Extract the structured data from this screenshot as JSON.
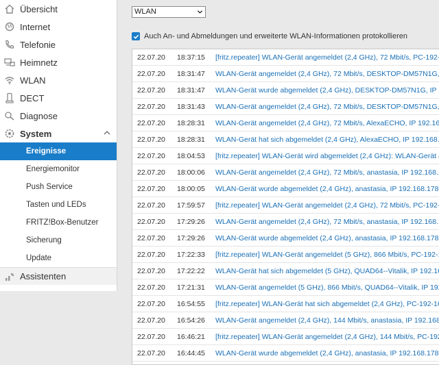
{
  "sidebar": {
    "items": [
      {
        "label": "Übersicht",
        "icon": "home-icon"
      },
      {
        "label": "Internet",
        "icon": "globe-icon"
      },
      {
        "label": "Telefonie",
        "icon": "phone-icon"
      },
      {
        "label": "Heimnetz",
        "icon": "network-icon"
      },
      {
        "label": "WLAN",
        "icon": "wifi-icon"
      },
      {
        "label": "DECT",
        "icon": "dect-handset-icon"
      },
      {
        "label": "Diagnose",
        "icon": "diagnose-icon"
      },
      {
        "label": "System",
        "icon": "gear-icon"
      }
    ],
    "system_subitems": [
      {
        "label": "Ereignisse",
        "active": true
      },
      {
        "label": "Energiemonitor"
      },
      {
        "label": "Push Service"
      },
      {
        "label": "Tasten und LEDs"
      },
      {
        "label": "FRITZ!Box-Benutzer"
      },
      {
        "label": "Sicherung"
      },
      {
        "label": "Update"
      }
    ],
    "assistant": {
      "label": "Assistenten",
      "icon": "wizard-icon"
    }
  },
  "filter": {
    "selected": "WLAN"
  },
  "log_option": {
    "label": "Auch An- und Abmeldungen und erweiterte WLAN-Informationen protokollieren",
    "checked": true
  },
  "log": {
    "rows": [
      {
        "date": "22.07.20",
        "time": "18:37:15",
        "msg": "[fritz.repeater] WLAN-Gerät angemeldet (2,4 GHz), 72 Mbit/s, PC-192-16"
      },
      {
        "date": "22.07.20",
        "time": "18:31:47",
        "msg": "WLAN-Gerät angemeldet (2,4 GHz), 72 Mbit/s, DESKTOP-DM57N1G, IP 1"
      },
      {
        "date": "22.07.20",
        "time": "18:31:47",
        "msg": "WLAN-Gerät wurde abgemeldet (2,4 GHz), DESKTOP-DM57N1G, IP 192."
      },
      {
        "date": "22.07.20",
        "time": "18:31:43",
        "msg": "WLAN-Gerät angemeldet (2,4 GHz), 72 Mbit/s, DESKTOP-DM57N1G, IP 1"
      },
      {
        "date": "22.07.20",
        "time": "18:28:31",
        "msg": "WLAN-Gerät angemeldet (2,4 GHz), 72 Mbit/s, AlexaECHO, IP 192.168.1"
      },
      {
        "date": "22.07.20",
        "time": "18:28:31",
        "msg": "WLAN-Gerät hat sich abgemeldet (2,4 GHz), AlexaECHO, IP 192.168.17"
      },
      {
        "date": "22.07.20",
        "time": "18:04:53",
        "msg": "[fritz.repeater] WLAN-Gerät wird abgemeldet (2,4 GHz): WLAN-Gerät ar"
      },
      {
        "date": "22.07.20",
        "time": "18:00:06",
        "msg": "WLAN-Gerät angemeldet (2,4 GHz), 72 Mbit/s, anastasia, IP 192.168.178"
      },
      {
        "date": "22.07.20",
        "time": "18:00:05",
        "msg": "WLAN-Gerät wurde abgemeldet (2,4 GHz), anastasia, IP 192.168.178.96"
      },
      {
        "date": "22.07.20",
        "time": "17:59:57",
        "msg": "[fritz.repeater] WLAN-Gerät angemeldet (2,4 GHz), 72 Mbit/s, PC-192-16"
      },
      {
        "date": "22.07.20",
        "time": "17:29:26",
        "msg": "WLAN-Gerät angemeldet (2,4 GHz), 72 Mbit/s, anastasia, IP 192.168.178"
      },
      {
        "date": "22.07.20",
        "time": "17:29:26",
        "msg": "WLAN-Gerät wurde abgemeldet (2,4 GHz), anastasia, IP 192.168.178.96"
      },
      {
        "date": "22.07.20",
        "time": "17:22:33",
        "msg": "[fritz.repeater] WLAN-Gerät angemeldet (5 GHz), 866 Mbit/s, PC-192-16"
      },
      {
        "date": "22.07.20",
        "time": "17:22:22",
        "msg": "WLAN-Gerät hat sich abgemeldet (5 GHz), QUAD64--Vitalik, IP 192.168."
      },
      {
        "date": "22.07.20",
        "time": "17:21:31",
        "msg": "WLAN-Gerät angemeldet (5 GHz), 866 Mbit/s, QUAD64--Vitalik, IP 192.1"
      },
      {
        "date": "22.07.20",
        "time": "16:54:55",
        "msg": "[fritz.repeater] WLAN-Gerät hat sich abgemeldet (2,4 GHz), PC-192-168"
      },
      {
        "date": "22.07.20",
        "time": "16:54:26",
        "msg": "WLAN-Gerät angemeldet (2,4 GHz), 144 Mbit/s, anastasia, IP 192.168.17"
      },
      {
        "date": "22.07.20",
        "time": "16:46:21",
        "msg": "[fritz.repeater] WLAN-Gerät angemeldet (2,4 GHz), 144 Mbit/s, PC-192-"
      },
      {
        "date": "22.07.20",
        "time": "16:44:45",
        "msg": "WLAN-Gerät wurde abgemeldet (2,4 GHz), anastasia, IP 192.168.178.96"
      }
    ]
  }
}
